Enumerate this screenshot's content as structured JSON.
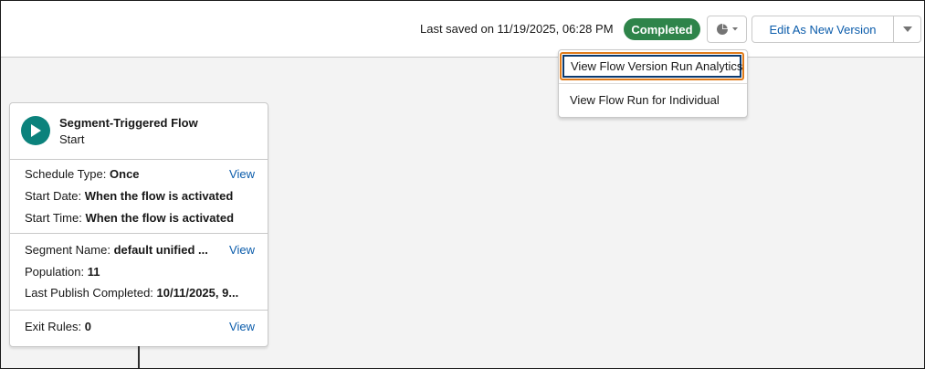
{
  "colors": {
    "badge_bg": "#2e844a",
    "link": "#0b5cab",
    "start_icon_bg": "#0b827c",
    "menu_highlight_outer": "#e07b1a",
    "menu_highlight_inner": "#0b3a6f"
  },
  "header": {
    "last_saved": "Last saved on 11/19/2025, 06:28 PM",
    "status_badge": "Completed",
    "analytics_button_icon": "pie-chart-icon",
    "edit_button_label": "Edit As New Version",
    "more_actions_icon": "chevron-down-icon"
  },
  "menu": {
    "items": [
      {
        "label": "View Flow Version Run Analytics",
        "highlighted": true
      },
      {
        "label": "View Flow Run for Individual",
        "highlighted": false
      }
    ]
  },
  "start_card": {
    "title": "Segment-Triggered Flow",
    "subtitle": "Start",
    "icon": "play-icon",
    "schedule": {
      "type_label": "Schedule Type:",
      "type_value": "Once",
      "start_date_label": "Start Date:",
      "start_date_value": "When the flow is activated",
      "start_time_label": "Start Time:",
      "start_time_value": "When the flow is activated",
      "view_label": "View"
    },
    "segment": {
      "name_label": "Segment Name:",
      "name_value": "default unified ...",
      "population_label": "Population:",
      "population_value": "11",
      "last_publish_label": "Last Publish Completed:",
      "last_publish_value": "10/11/2025, 9...",
      "view_label": "View"
    },
    "exit_rules": {
      "label": "Exit Rules:",
      "value": "0",
      "view_label": "View"
    }
  }
}
